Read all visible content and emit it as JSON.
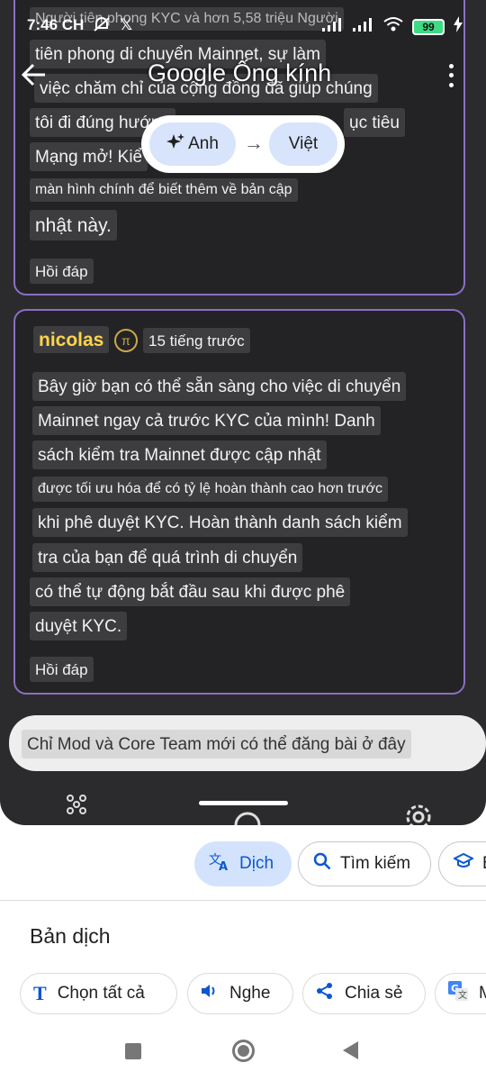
{
  "status_bar": {
    "time": "7:46 CH",
    "battery": "99"
  },
  "lens": {
    "title": "Google Ống kính",
    "source_lang": "Anh",
    "target_lang": "Việt"
  },
  "card1": {
    "lines": [
      "Người tiên phong KYC và hơn 5,58 triệu Người",
      "tiên phong di chuyển Mainnet, sự làm",
      "việc chăm chỉ của cộng đồng đã giúp chúng",
      "tôi đi đúng hướng",
      "ục tiêu",
      "Mạng mở! Kiể",
      "màn hình chính để biết thêm về bản cập",
      "nhật này."
    ],
    "reply": "Hồi đáp"
  },
  "card2": {
    "user": "nicolas",
    "badge": "π",
    "time_ago": "15 tiếng trước",
    "lines": [
      "Bây giờ bạn có thể sẵn sàng cho việc di chuyển",
      "Mainnet ngay cả trước KYC của mình! Danh",
      "sách kiểm tra Mainnet được cập nhật",
      "được tối ưu hóa để có tỷ lệ hoàn thành cao hơn trước",
      "khi phê duyệt KYC. Hoàn thành danh sách kiểm",
      "tra của bạn để quá trình di chuyển",
      "có thể tự động bắt đầu sau khi được phê",
      "duyệt KYC."
    ],
    "reply": "Hồi đáp"
  },
  "compose": {
    "text": "Chỉ Mod và Core Team mới có thể đăng bài ở đây"
  },
  "chips": {
    "translate": "Dịch",
    "search": "Tìm kiếm",
    "homework": "B"
  },
  "panel": {
    "title": "Bản dịch",
    "select_all": "Chọn tất cả",
    "listen": "Nghe",
    "share": "Chia sẻ",
    "more": "M"
  },
  "colors": {
    "accent": "#0b57d0",
    "card_border": "#8b6fc4",
    "username": "#ffd54a"
  }
}
